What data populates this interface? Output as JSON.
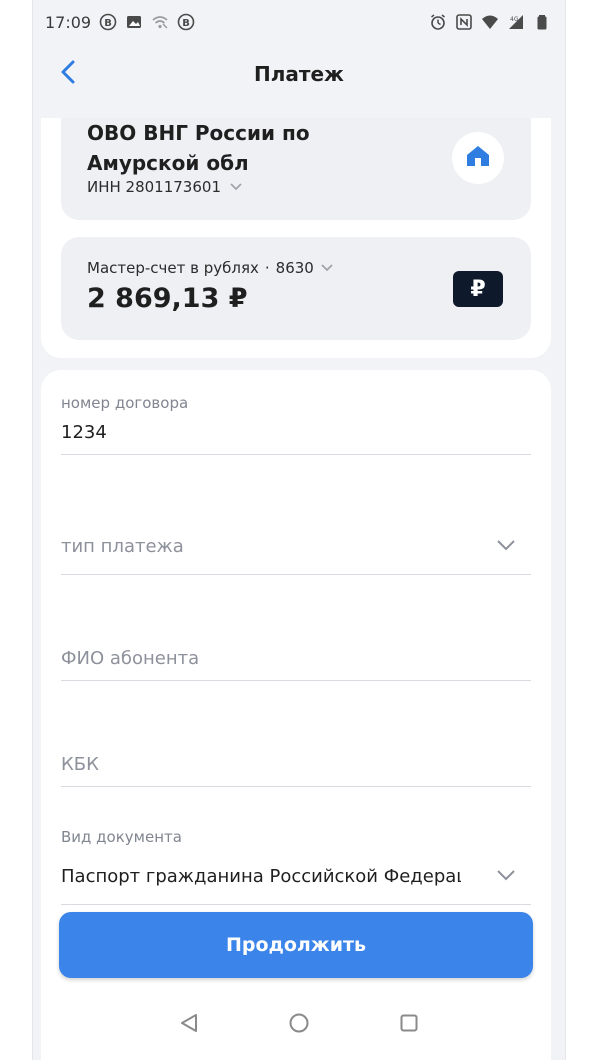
{
  "status_bar": {
    "time": "17:09",
    "icons_left": [
      "b-badge-icon",
      "image-icon",
      "wifi-off-icon",
      "b-badge-icon"
    ],
    "icons_right": [
      "alarm-icon",
      "nfc-icon",
      "wifi-icon",
      "signal-icon",
      "battery-icon"
    ]
  },
  "header": {
    "title": "Платеж",
    "back_icon": "chevron-left-icon"
  },
  "recipient": {
    "name": "ОВО ВНГ России по Амурской обл",
    "inn": "ИНН 2801173601",
    "icon": "home-icon"
  },
  "account": {
    "name": "Мастер-счет в рублях",
    "separator": "·",
    "number": "8630",
    "balance": "2 869,13 ₽",
    "currency_symbol": "₽"
  },
  "form": {
    "contract": {
      "label": "номер договора",
      "value": "1234"
    },
    "payment_type": {
      "placeholder": "тип платежа"
    },
    "subscriber_name": {
      "placeholder": "ФИО абонента"
    },
    "kbk": {
      "placeholder": "КБК"
    },
    "document_type": {
      "label": "Вид документа",
      "value": "Паспорт гражданина Российской Федерации"
    }
  },
  "actions": {
    "continue_label": "Продолжить"
  },
  "colors": {
    "accent": "#3a84ea",
    "background": "#f2f3f7",
    "card": "#eff0f4",
    "ruble_badge": "#0e1a2b"
  }
}
